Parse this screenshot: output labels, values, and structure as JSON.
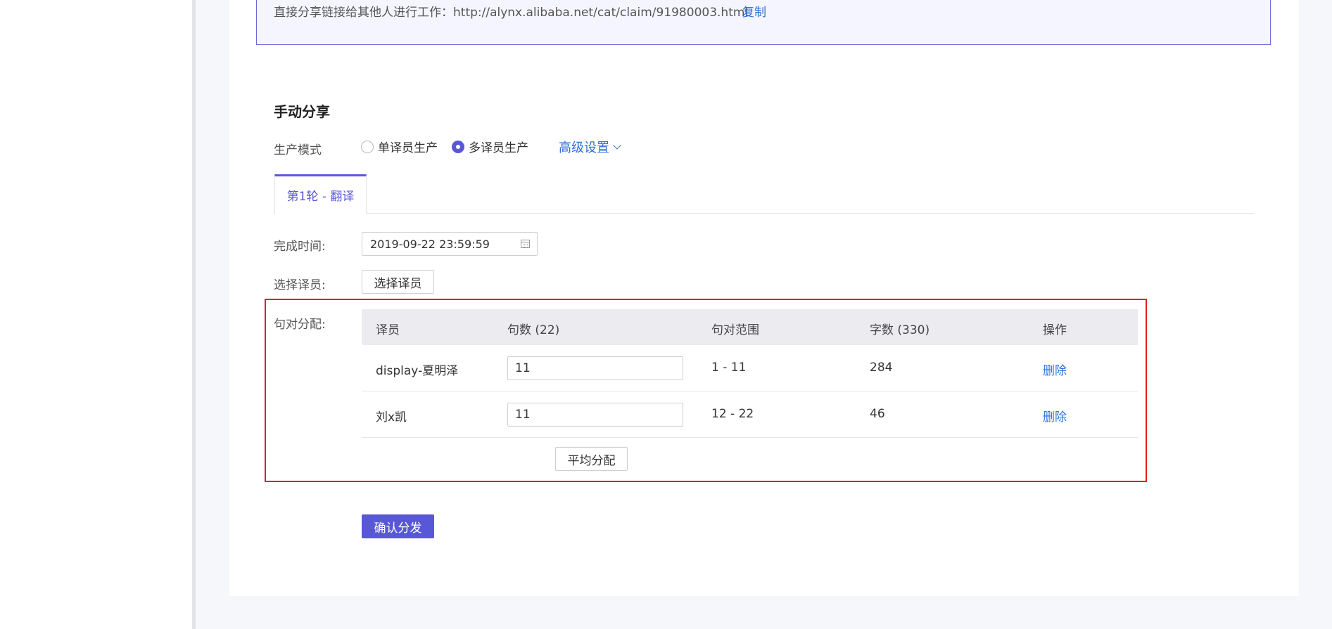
{
  "share": {
    "text": "直接分享链接给其他人进行工作：http://alynx.alibaba.net/cat/claim/91980003.html",
    "copy_label": "复制"
  },
  "manual_share": {
    "title": "手动分享",
    "mode_label": "生产模式",
    "modes": [
      {
        "label": "单译员生产",
        "checked": false
      },
      {
        "label": "多译员生产",
        "checked": true
      }
    ],
    "advanced_label": "高级设置"
  },
  "tabs": [
    {
      "label": "第1轮 - 翻译",
      "active": true
    }
  ],
  "form": {
    "complete_time_label": "完成时间:",
    "complete_time_value": "2019-09-22 23:59:59",
    "select_translator_label": "选择译员:",
    "select_translator_button": "选择译员",
    "allocation_label": "句对分配:"
  },
  "table": {
    "headers": [
      "译员",
      "句数 (22)",
      "句对范围",
      "字数 (330)",
      "操作"
    ],
    "rows": [
      {
        "translator": "display-夏明泽",
        "sentences": "11",
        "range": "1 - 11",
        "words": "284",
        "action": "删除"
      },
      {
        "translator": "刘x凯",
        "sentences": "11",
        "range": "12 - 22",
        "words": "46",
        "action": "删除"
      }
    ],
    "average_button": "平均分配"
  },
  "confirm_button": "确认分发",
  "colors": {
    "primary": "#5858d6",
    "link": "#2f6fd6",
    "highlight": "#e02020"
  }
}
